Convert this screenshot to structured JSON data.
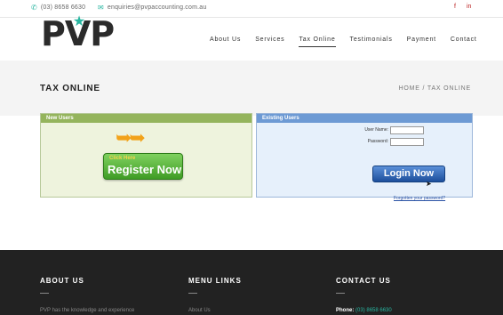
{
  "topbar": {
    "phone": "(03) 8658 6630",
    "email": "enquiries@pvpaccounting.com.au",
    "social": [
      "f",
      "in"
    ]
  },
  "logo": {
    "text_p1": "P",
    "text_v": "V",
    "text_p2": "P"
  },
  "nav": {
    "items": [
      "About Us",
      "Services",
      "Tax Online",
      "Testimonials",
      "Payment",
      "Contact"
    ],
    "active_index": 2
  },
  "page_title": "TAX ONLINE",
  "breadcrumb": "HOME / TAX ONLINE",
  "new_users": {
    "heading": "New Users",
    "click_here": "Click Here",
    "register_label": "Register Now"
  },
  "existing_users": {
    "heading": "Existing Users",
    "username_label": "User Name:",
    "username_value": "",
    "password_label": "Password:",
    "password_value": "",
    "login_label": "Login Now",
    "forgot_label": "Forgotten your password?"
  },
  "footer": {
    "about_heading": "ABOUT US",
    "about_text": "PVP has the knowledge and experience",
    "menu_heading": "MENU LINKS",
    "menu_first": "About Us",
    "contact_heading": "CONTACT US",
    "phone_label": "Phone:",
    "phone_value": "(03) 8658 6630"
  },
  "colors": {
    "accent": "#29b6a1",
    "green_panel": "#94b45c",
    "blue_panel": "#6d9ad4",
    "footer_bg": "#222222"
  },
  "icons": [
    "phone-icon",
    "mail-icon",
    "facebook-icon",
    "linkedin-icon",
    "star-icon",
    "cursor-icon"
  ]
}
